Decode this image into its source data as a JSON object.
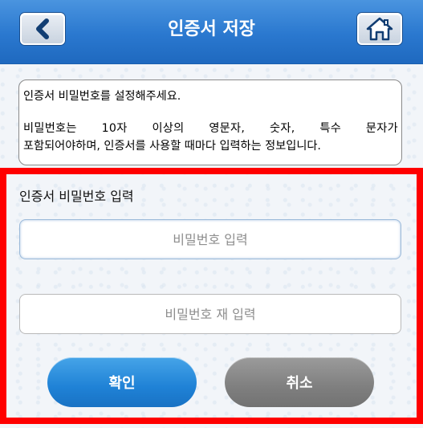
{
  "header": {
    "title": "인증서 저장",
    "back_icon": "chevron-left-icon",
    "home_icon": "home-icon",
    "color": "#2a78cf"
  },
  "notice": {
    "line1": "인증서 비밀번호를 설정해주세요.",
    "line2": "비밀번호는 10자 이상의 영문자, 숫자, 특수 문자가",
    "line3": "포함되어야하며, 인증서를 사용할 때마다 입력하는 정보입니다."
  },
  "form": {
    "label": "인증서 비밀번호 입력",
    "password_placeholder": "비밀번호 입력",
    "confirm_placeholder": "비밀번호 재 입력",
    "password_value": "",
    "confirm_value": "",
    "highlight_color": "#ff0000"
  },
  "buttons": {
    "ok_label": "확인",
    "cancel_label": "취소",
    "ok_color": "#1f82d6",
    "cancel_color": "#7f7f7f"
  }
}
